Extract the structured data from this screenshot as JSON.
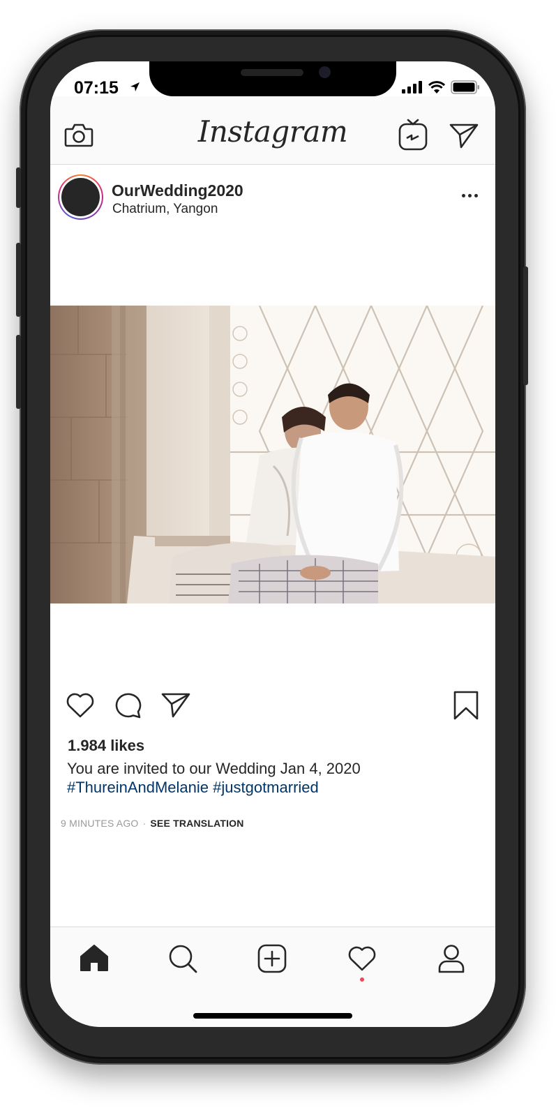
{
  "status_bar": {
    "time": "07:15"
  },
  "header": {
    "logo": "Instagram"
  },
  "post": {
    "username": "OurWedding2020",
    "location": "Chatrium, Yangon",
    "likes_count": "1.984",
    "likes_label": "likes",
    "caption": "You are invited to our Wedding Jan 4, 2020",
    "hashtags": "#ThureinAndMelanie #justgotmarried",
    "time_ago": "9 MINUTES AGO",
    "meta_separator": "·",
    "see_translation": "SEE TRANSLATION"
  },
  "icons": {
    "header": [
      "camera-icon",
      "igtv-icon",
      "direct-message-icon"
    ],
    "post_actions": [
      "heart-icon",
      "comment-icon",
      "share-icon",
      "bookmark-icon"
    ],
    "tab_bar": [
      "home-icon",
      "search-icon",
      "add-post-icon",
      "activity-heart-icon",
      "profile-icon"
    ]
  },
  "colors": {
    "text": "#262626",
    "hashtag": "#003569",
    "muted": "#999999",
    "notification_dot": "#ed4956"
  }
}
